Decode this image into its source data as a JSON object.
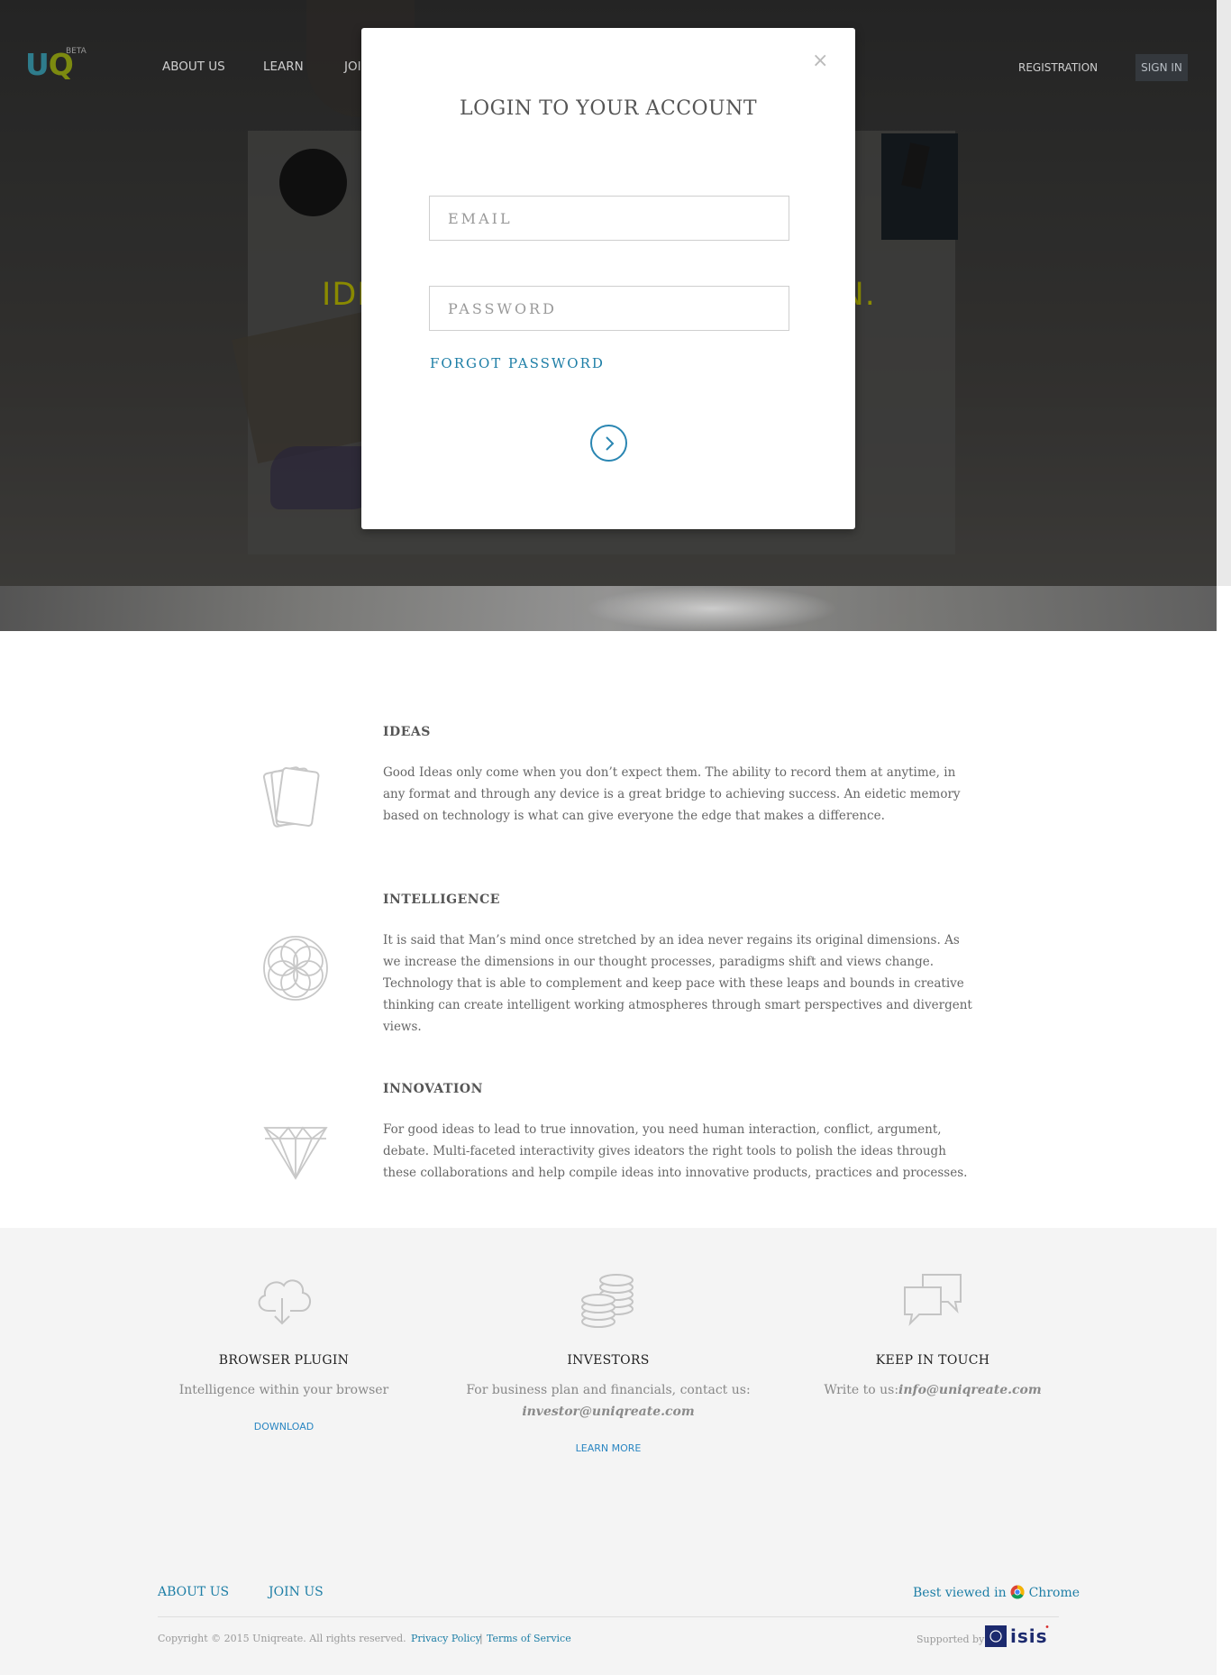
{
  "nav": {
    "logo_u": "U",
    "logo_q": "Q",
    "logo_beta": "BETA",
    "about": "ABOUT US",
    "learn": "LEARN",
    "join_partial": "JOI",
    "registration": "REGISTRATION",
    "signin": "SIGN IN"
  },
  "hero": {
    "tagline_left": "IDE",
    "tagline_right": "ON."
  },
  "modal": {
    "close": "×",
    "title": "LOGIN TO YOUR ACCOUNT",
    "email_placeholder": "EMAIL",
    "password_placeholder": "PASSWORD",
    "forgot": "FORGOT PASSWORD",
    "accent": "#1d7ea6"
  },
  "features": [
    {
      "icon": "cards-icon",
      "title": "IDEAS",
      "text": "Good Ideas only come when you don’t expect them. The ability to record them at anytime, in any format and through any device is a great bridge to achieving success. An eidetic memory based on technology is what can give everyone the edge that makes a difference."
    },
    {
      "icon": "flower-of-life-icon",
      "title": "INTELLIGENCE",
      "text": "It is said that Man’s mind once stretched by an idea never regains its original dimensions. As we increase the dimensions in our thought processes, paradigms shift and views change. Technology that is able to complement and keep pace with these leaps and bounds in creative thinking can create intelligent working atmospheres through smart perspectives and divergent views."
    },
    {
      "icon": "diamond-icon",
      "title": "INNOVATION",
      "text": "For good ideas to lead to true innovation, you need human interaction, conflict, argument, debate. Multi-faceted interactivity gives ideators the right tools to polish the ideas through these collaborations and help compile ideas into innovative products, practices and processes."
    }
  ],
  "info": {
    "plugin": {
      "icon": "cloud-download-icon",
      "title": "BROWSER PLUGIN",
      "text": "Intelligence within your browser",
      "link": "DOWNLOAD"
    },
    "investors": {
      "icon": "coins-icon",
      "title": "INVESTORS",
      "text": "For business plan and financials, contact us:",
      "email": "investor@uniqreate.com",
      "link": "LEARN MORE"
    },
    "touch": {
      "icon": "chat-bubbles-icon",
      "title": "KEEP IN TOUCH",
      "text": "Write to us:",
      "email": "info@uniqreate.com"
    }
  },
  "footer": {
    "about": "ABOUT US",
    "join": "JOIN US",
    "best_viewed": "Best viewed in",
    "browser": "Chrome",
    "copyright": "Copyright © 2015 Uniqreate. All rights reserved.",
    "privacy": "Privacy Policy",
    "separator": "|",
    "terms": "Terms of Service",
    "supported": "Supported by",
    "supporter_logo_text": "isis"
  }
}
